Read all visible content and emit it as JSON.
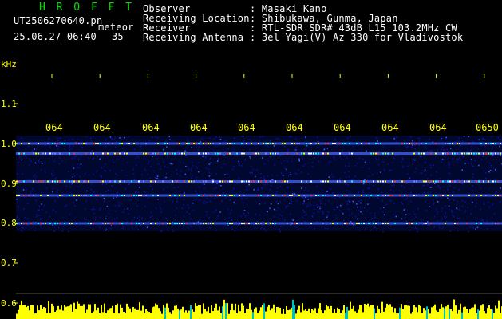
{
  "header": {
    "title": "H R O F F T",
    "filename": "UT2506270640.pn",
    "type_label": "meteor",
    "datetime": "25.06.27 06:40",
    "count": "35",
    "info_labels": [
      "Observer",
      "Receiving Location",
      "Receiver",
      "Receiving Antenna"
    ],
    "info_values": [
      ": Masaki Kano",
      ": Shibukawa, Gunma, Japan",
      ": RTL-SDR SDR# 43dB L15 103.2MHz CW",
      ": 3el Yagi(V) Az 330 for Vladivostok"
    ]
  },
  "x_axis": {
    "ticks": [
      "064",
      "064",
      "064",
      "064",
      "064",
      "064",
      "064",
      "064",
      "064",
      "0650"
    ]
  },
  "y_axis": {
    "unit": "kHz",
    "ticks": [
      "1.1",
      "1.0",
      "0.9",
      "0.8",
      "0.7",
      "0.6"
    ]
  },
  "spectrogram": {
    "bands_khz": [
      1.0,
      0.975,
      0.905,
      0.87,
      0.8
    ],
    "band_colors": [
      "#ffffff",
      "#ff3030",
      "#ffff00",
      "#00ffff",
      "#8080ff"
    ],
    "noise_low_khz": 0.78,
    "noise_high_khz": 1.02,
    "background_color": "#000000",
    "noise_color": "#1010a0",
    "signal_bar_color": "#ffff00"
  }
}
